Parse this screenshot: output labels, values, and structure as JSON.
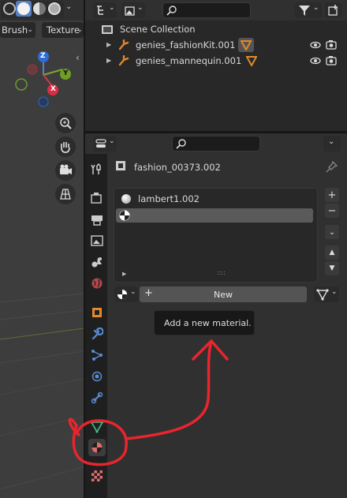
{
  "viewport": {
    "header": {
      "brush_label": "Brush",
      "texture_label": "Texture"
    },
    "gizmo": {
      "z": "Z",
      "y": "Y",
      "x": "X"
    }
  },
  "outliner": {
    "scene_collection": "Scene Collection",
    "items": [
      {
        "label": "genies_fashionKit.001"
      },
      {
        "label": "genies_mannequin.001"
      }
    ]
  },
  "properties": {
    "object_name": "fashion_00373.002",
    "material_slots": [
      {
        "label": "lambert1.002"
      },
      {
        "label": ""
      }
    ],
    "new_button_label": "New",
    "tooltip": "Add a new material.",
    "grip": "::::"
  },
  "colors": {
    "annotation_red": "#e8252d",
    "object_orange": "#e0892c",
    "material_pink": "#e26d6d",
    "active_tab_bg": "#3d3d3d"
  }
}
